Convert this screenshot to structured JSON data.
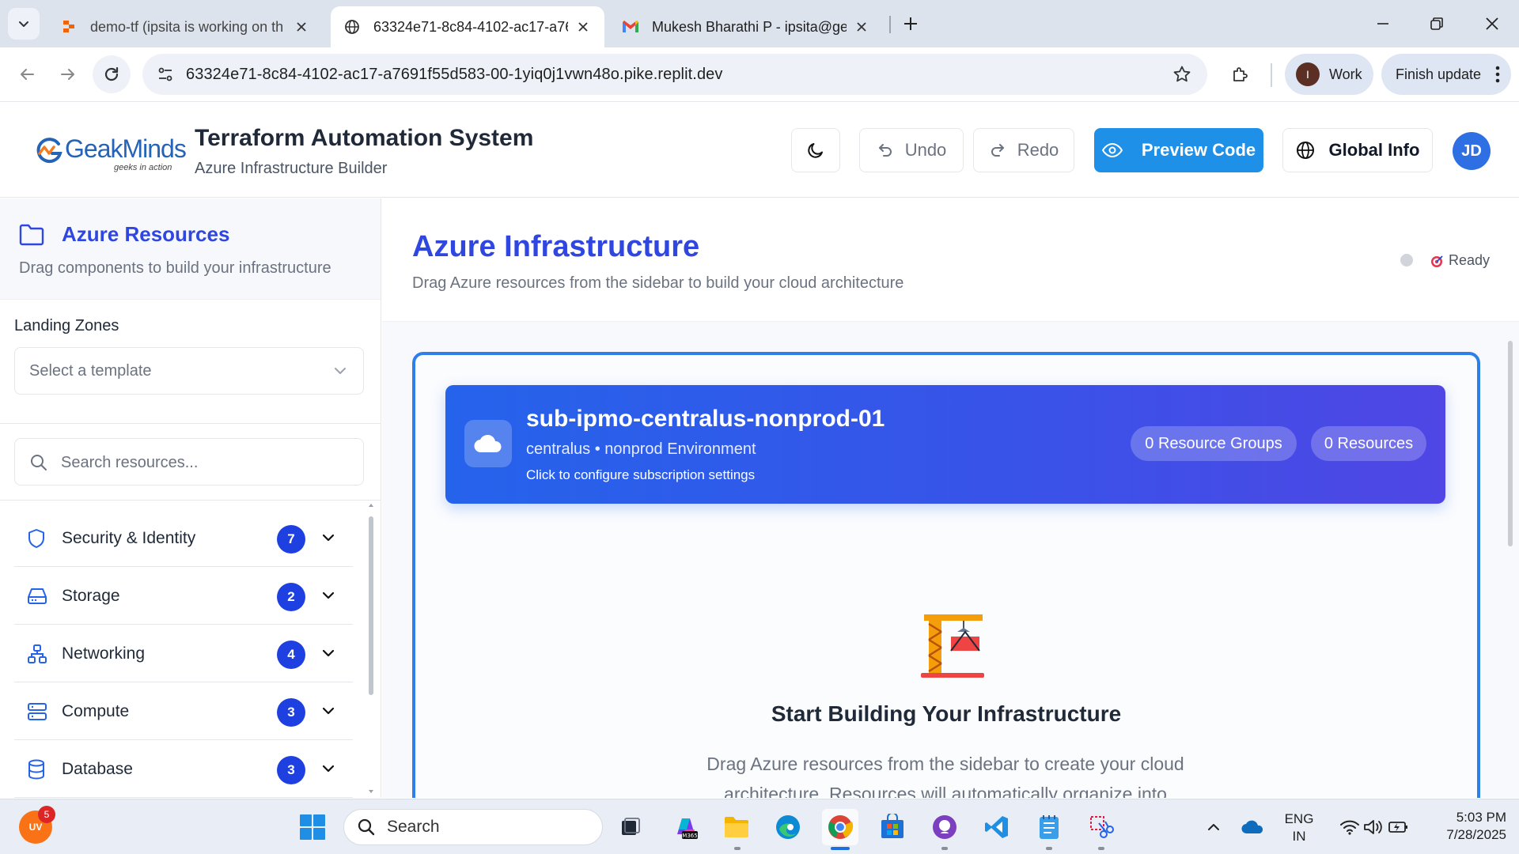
{
  "browser": {
    "tabs": [
      {
        "title": "demo-tf (ipsita is working on th",
        "active": false
      },
      {
        "title": "63324e71-8c84-4102-ac17-a76",
        "active": true
      },
      {
        "title": "Mukesh Bharathi P - ipsita@ge",
        "active": false
      }
    ],
    "url": "63324e71-8c84-4102-ac17-a7691f55d583-00-1yiq0j1vwn48o.pike.replit.dev",
    "profile_initial": "I",
    "profile_label": "Work",
    "update_label": "Finish update"
  },
  "header": {
    "logo_text": "GeakMinds",
    "logo_tagline": "geeks in action",
    "title": "Terraform Automation System",
    "subtitle": "Azure Infrastructure Builder",
    "undo_label": "Undo",
    "redo_label": "Redo",
    "preview_label": "Preview Code",
    "global_label": "Global Info",
    "avatar_initials": "JD"
  },
  "sidebar": {
    "title": "Azure Resources",
    "subtitle": "Drag components to build your infrastructure",
    "landing_zones_label": "Landing Zones",
    "template_placeholder": "Select a template",
    "search_placeholder": "Search resources...",
    "categories": [
      {
        "label": "Security & Identity",
        "count": "7",
        "icon": "shield-icon"
      },
      {
        "label": "Storage",
        "count": "2",
        "icon": "storage-icon"
      },
      {
        "label": "Networking",
        "count": "4",
        "icon": "network-icon"
      },
      {
        "label": "Compute",
        "count": "3",
        "icon": "server-icon"
      },
      {
        "label": "Database",
        "count": "3",
        "icon": "database-icon"
      }
    ]
  },
  "main": {
    "title": "Azure Infrastructure",
    "subtitle": "Drag Azure resources from the sidebar to build your cloud architecture",
    "status": "Ready",
    "subscription": {
      "name": "sub-ipmo-centralus-nonprod-01",
      "env": "centralus • nonprod Environment",
      "hint": "Click to configure subscription settings",
      "resource_groups": "0 Resource Groups",
      "resources": "0 Resources"
    },
    "empty_title": "Start Building Your Infrastructure",
    "empty_desc": "Drag Azure resources from the sidebar to create your cloud architecture. Resources will automatically organize into"
  },
  "taskbar": {
    "search_placeholder": "Search",
    "notification_badge": "5",
    "lang_line1": "ENG",
    "lang_line2": "IN",
    "time": "5:03 PM",
    "date": "7/28/2025",
    "user_initials": "UV"
  },
  "colors": {
    "brand_blue": "#2f46e0",
    "preview_button": "#1e90e8",
    "badge": "#1e40e0",
    "canvas_border": "#2f7fe8"
  }
}
